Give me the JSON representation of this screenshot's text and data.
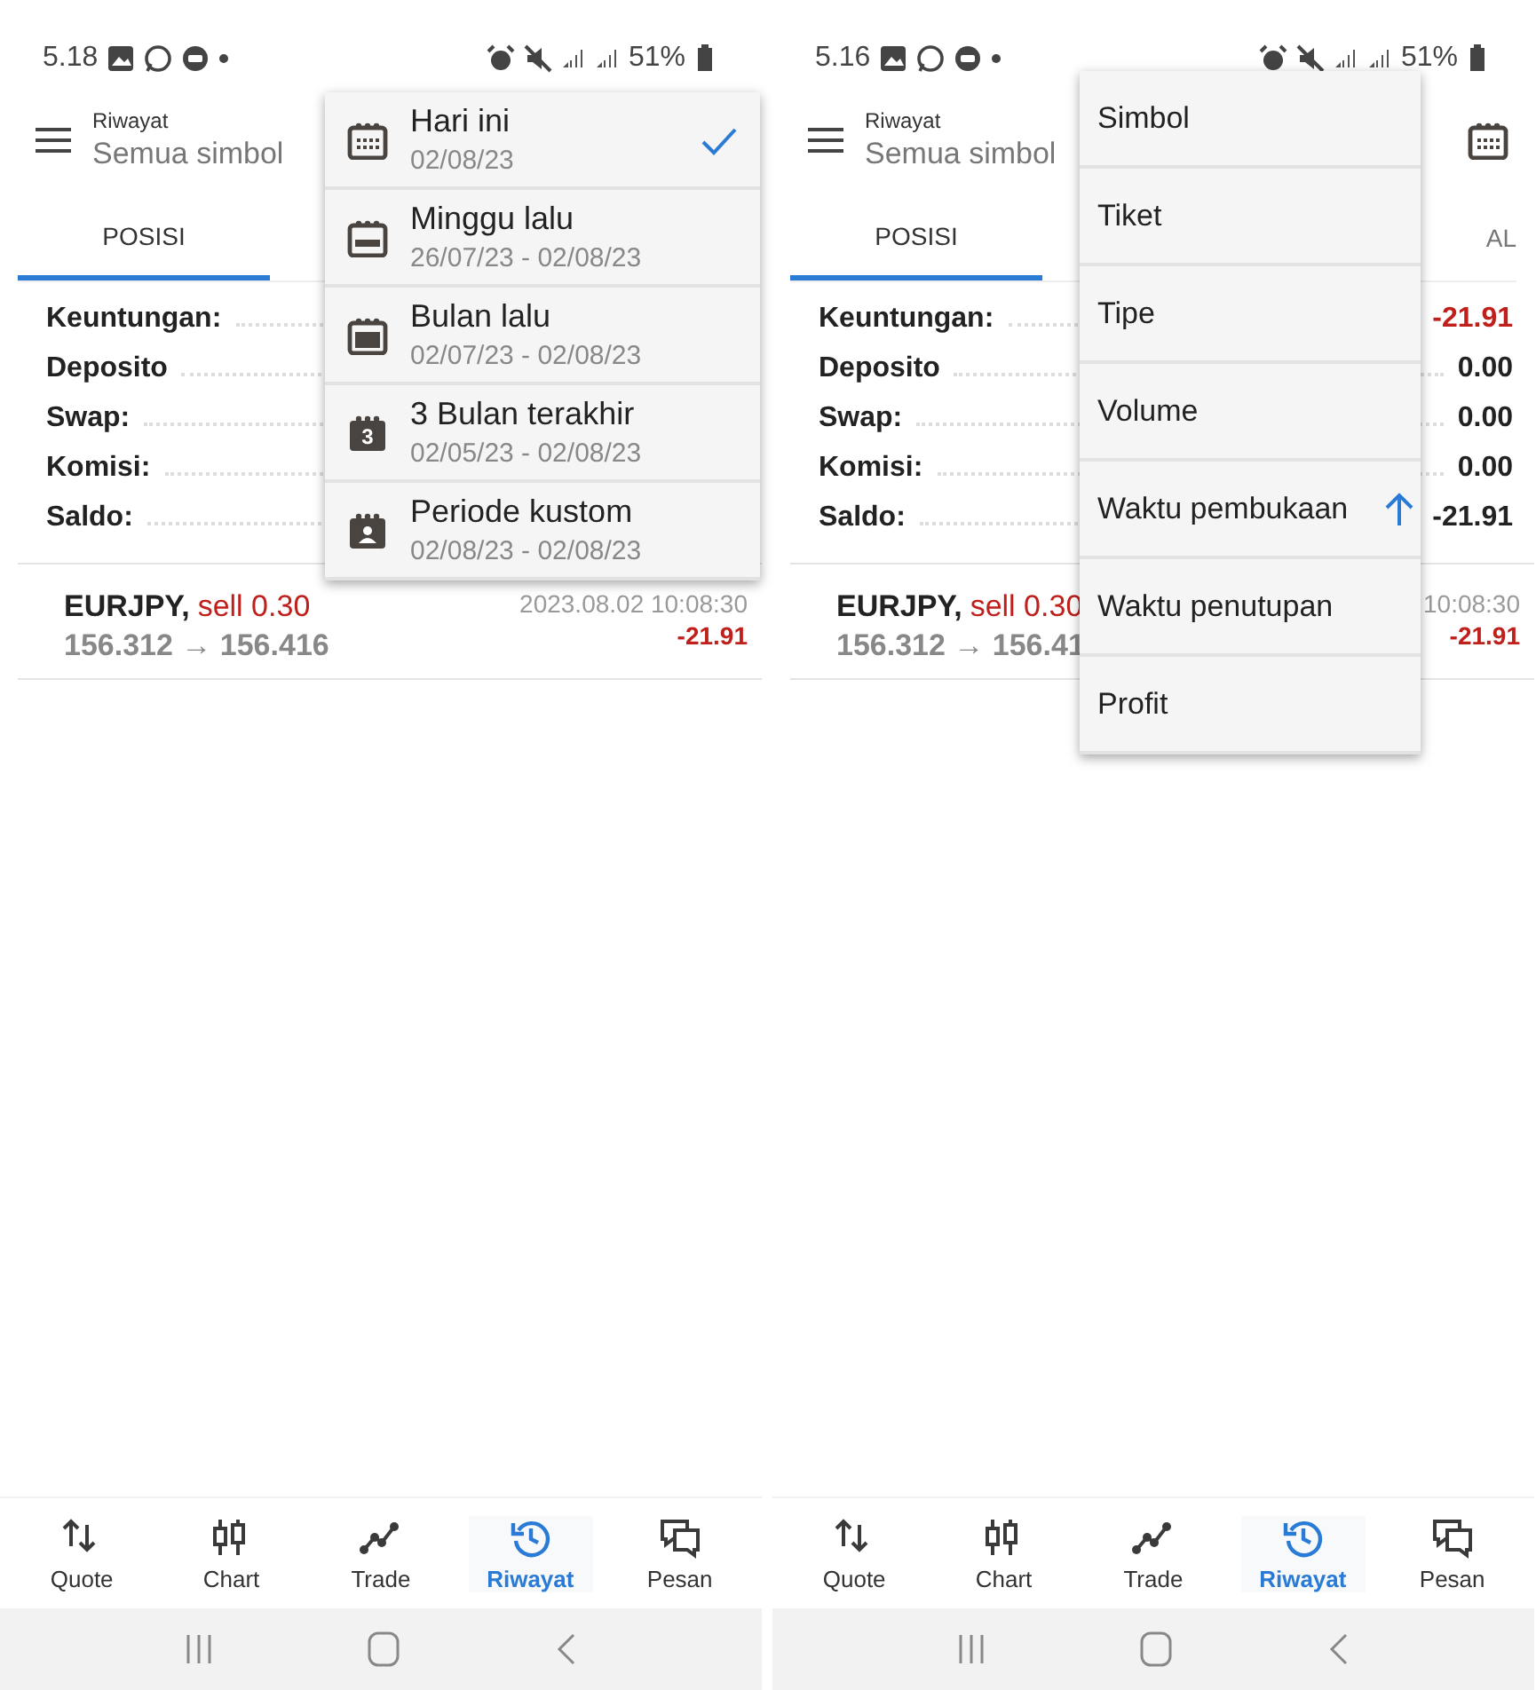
{
  "phones": [
    {
      "status_bar": {
        "time": "5.18",
        "battery": "51%"
      },
      "header": {
        "title": "Riwayat",
        "subtitle": "Semua simbol"
      },
      "tabs": [
        {
          "label": "POSISI",
          "selected": true
        }
      ],
      "summary": [
        {
          "label": "Keuntungan:"
        },
        {
          "label": "Deposito"
        },
        {
          "label": "Swap:"
        },
        {
          "label": "Komisi:"
        },
        {
          "label": "Saldo:"
        }
      ],
      "trades": [
        {
          "symbol": "EURJPY,",
          "side": "sell 0.30",
          "prices": "156.312 → 156.416",
          "time": "2023.08.02 10:08:30",
          "profit": "-21.91",
          "loss": true
        }
      ],
      "menu": {
        "kind": "period",
        "items": [
          {
            "kind": "today",
            "label": "Hari ini",
            "range": "02/08/23",
            "selected": true
          },
          {
            "kind": "week",
            "label": "Minggu lalu",
            "range": "26/07/23 - 02/08/23",
            "selected": false
          },
          {
            "kind": "month",
            "label": "Bulan lalu",
            "range": "02/07/23 - 02/08/23",
            "selected": false
          },
          {
            "kind": "quarter",
            "label": "3 Bulan terakhir",
            "badge": "3",
            "range": "02/05/23 - 02/08/23",
            "selected": false
          },
          {
            "kind": "custom",
            "label": "Periode kustom",
            "range": "02/08/23 - 02/08/23",
            "selected": false
          }
        ]
      },
      "nav": [
        {
          "label": "Quote",
          "selected": false
        },
        {
          "label": "Chart",
          "selected": false
        },
        {
          "label": "Trade",
          "selected": false
        },
        {
          "label": "Riwayat",
          "selected": true
        },
        {
          "label": "Pesan",
          "selected": false
        }
      ]
    },
    {
      "status_bar": {
        "time": "5.16",
        "battery": "51%"
      },
      "header": {
        "title": "Riwayat",
        "subtitle": "Semua simbol"
      },
      "tabs": [
        {
          "label": "POSISI",
          "selected": true
        },
        {
          "label": "AL",
          "selected": false
        }
      ],
      "summary": [
        {
          "label": "Keuntungan:",
          "value": "-21.91",
          "loss": true
        },
        {
          "label": "Deposito",
          "value": "0.00",
          "loss": false
        },
        {
          "label": "Swap:",
          "value": "0.00",
          "loss": false
        },
        {
          "label": "Komisi:",
          "value": "0.00",
          "loss": false
        },
        {
          "label": "Saldo:",
          "value": "-21.91",
          "loss": false
        }
      ],
      "trades": [
        {
          "symbol": "EURJPY,",
          "side": "sell 0.30",
          "prices": "156.312 → 156.41",
          "time": "10:08:30",
          "profit": "-21.91",
          "loss": true
        }
      ],
      "menu": {
        "kind": "sort",
        "items": [
          {
            "label": "Simbol",
            "selected": false
          },
          {
            "label": "Tiket",
            "selected": false
          },
          {
            "label": "Tipe",
            "selected": false
          },
          {
            "label": "Volume",
            "selected": false
          },
          {
            "label": "Waktu pembukaan",
            "selected": true
          },
          {
            "label": "Waktu penutupan",
            "selected": false
          },
          {
            "label": "Profit",
            "selected": false
          }
        ]
      },
      "nav": [
        {
          "label": "Quote",
          "selected": false
        },
        {
          "label": "Chart",
          "selected": false
        },
        {
          "label": "Trade",
          "selected": false
        },
        {
          "label": "Riwayat",
          "selected": true
        },
        {
          "label": "Pesan",
          "selected": false
        }
      ]
    }
  ]
}
